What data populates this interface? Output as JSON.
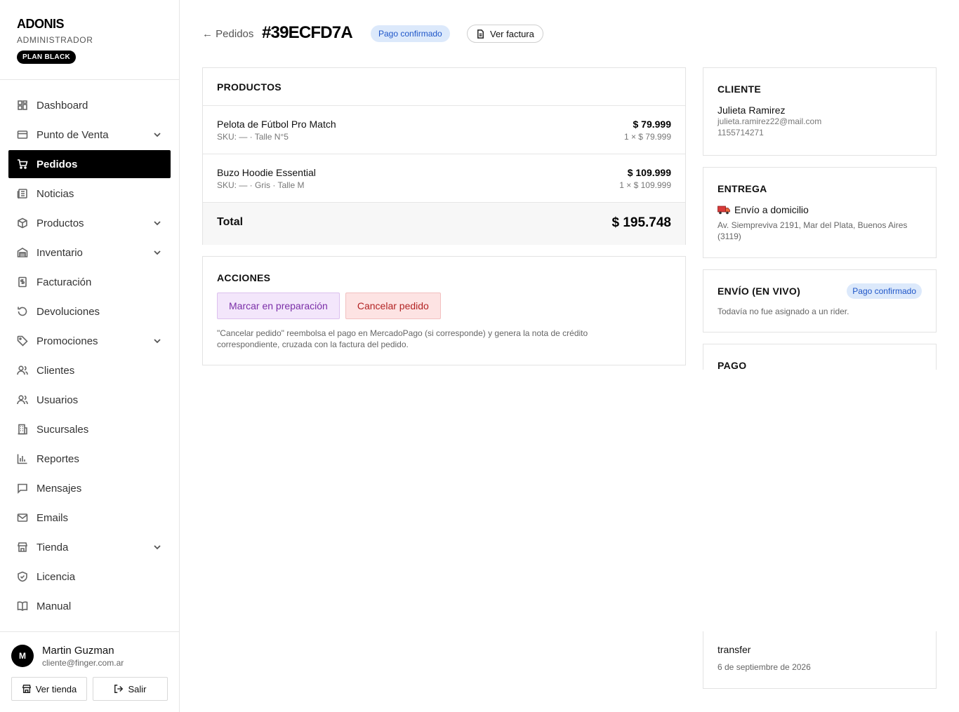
{
  "brand": {
    "name": "ADONIS",
    "role": "ADMINISTRADOR",
    "plan": "PLAN BLACK"
  },
  "nav": [
    {
      "label": "Dashboard",
      "icon": "dashboard-icon",
      "chevron": false,
      "active": false
    },
    {
      "label": "Punto de Venta",
      "icon": "pos-icon",
      "chevron": true,
      "active": false
    },
    {
      "label": "Pedidos",
      "icon": "cart-icon",
      "chevron": false,
      "active": true
    },
    {
      "label": "Noticias",
      "icon": "newspaper-icon",
      "chevron": false,
      "active": false
    },
    {
      "label": "Productos",
      "icon": "box-icon",
      "chevron": true,
      "active": false
    },
    {
      "label": "Inventario",
      "icon": "warehouse-icon",
      "chevron": true,
      "active": false
    },
    {
      "label": "Facturación",
      "icon": "invoice-icon",
      "chevron": false,
      "active": false
    },
    {
      "label": "Devoluciones",
      "icon": "return-icon",
      "chevron": false,
      "active": false
    },
    {
      "label": "Promociones",
      "icon": "tag-icon",
      "chevron": true,
      "active": false
    },
    {
      "label": "Clientes",
      "icon": "users-icon",
      "chevron": false,
      "active": false
    },
    {
      "label": "Usuarios",
      "icon": "users-icon",
      "chevron": false,
      "active": false
    },
    {
      "label": "Sucursales",
      "icon": "building-icon",
      "chevron": false,
      "active": false
    },
    {
      "label": "Reportes",
      "icon": "bar-chart-icon",
      "chevron": false,
      "active": false
    },
    {
      "label": "Mensajes",
      "icon": "message-icon",
      "chevron": false,
      "active": false
    },
    {
      "label": "Emails",
      "icon": "mail-icon",
      "chevron": false,
      "active": false
    },
    {
      "label": "Tienda",
      "icon": "store-icon",
      "chevron": true,
      "active": false
    },
    {
      "label": "Licencia",
      "icon": "shield-check-icon",
      "chevron": false,
      "active": false
    },
    {
      "label": "Manual",
      "icon": "book-icon",
      "chevron": false,
      "active": false
    }
  ],
  "user": {
    "initial": "M",
    "name": "Martin Guzman",
    "email": "cliente@finger.com.ar",
    "view_store_label": "Ver tienda",
    "logout_label": "Salir"
  },
  "header": {
    "back_label": "← Pedidos",
    "order_id": "#39ECFD7A",
    "status": "Pago confirmado",
    "invoice_label": "Ver factura"
  },
  "products": {
    "title": "PRODUCTOS",
    "items": [
      {
        "name": "Pelota de Fútbol Pro Match",
        "sku": "SKU: — · Talle N°5",
        "price": "$ 79.999",
        "qty": "1 × $ 79.999"
      },
      {
        "name": "Buzo Hoodie Essential",
        "sku": "SKU: — · Gris · Talle M",
        "price": "$ 109.999",
        "qty": "1 × $ 109.999"
      }
    ],
    "total_label": "Total",
    "total_value": "$ 195.748"
  },
  "actions": {
    "title": "ACCIONES",
    "prepare_label": "Marcar en preparación",
    "cancel_label": "Cancelar pedido",
    "note": "\"Cancelar pedido\" reembolsa el pago en MercadoPago (si corresponde) y genera la nota de crédito correspondiente, cruzada con la factura del pedido."
  },
  "client": {
    "title": "CLIENTE",
    "name": "Julieta Ramirez",
    "email": "julieta.ramirez22@mail.com",
    "phone": "1155714271"
  },
  "delivery": {
    "title": "ENTREGA",
    "mode": "Envío a domicilio",
    "address": "Av. Siempreviva 2191, Mar del Plata, Buenos Aires (3119)"
  },
  "live_shipping": {
    "title": "ENVÍO (EN VIVO)",
    "status": "Pago confirmado",
    "note": "Todavía no fue asignado a un rider."
  },
  "payment": {
    "title": "PAGO",
    "method": "transfer",
    "date": "6 de septiembre de 2026"
  },
  "colors": {
    "accent_black": "#000000",
    "status_blue_bg": "#dce9fb",
    "status_blue_text": "#1f56c8",
    "prepare_purple": "#7b2fa8",
    "cancel_red": "#b32424"
  }
}
